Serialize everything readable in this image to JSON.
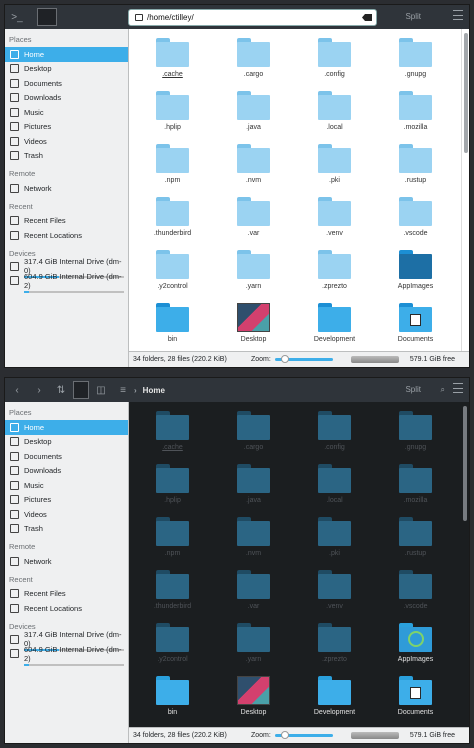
{
  "windows": [
    {
      "path": "/home/ctilley/",
      "split_label": "Split",
      "sidebar": {
        "sections": [
          {
            "title": "Places",
            "items": [
              {
                "label": "Home",
                "icon": "home-icon",
                "selected": true
              },
              {
                "label": "Desktop",
                "icon": "desktop-icon"
              },
              {
                "label": "Documents",
                "icon": "documents-icon"
              },
              {
                "label": "Downloads",
                "icon": "downloads-icon"
              },
              {
                "label": "Music",
                "icon": "music-icon"
              },
              {
                "label": "Pictures",
                "icon": "pictures-icon"
              },
              {
                "label": "Videos",
                "icon": "videos-icon"
              },
              {
                "label": "Trash",
                "icon": "trash-icon"
              }
            ]
          },
          {
            "title": "Remote",
            "items": [
              {
                "label": "Network",
                "icon": "network-icon"
              }
            ]
          },
          {
            "title": "Recent",
            "items": [
              {
                "label": "Recent Files",
                "icon": "recent-files-icon"
              },
              {
                "label": "Recent Locations",
                "icon": "recent-locations-icon"
              }
            ]
          }
        ],
        "devices_title": "Devices",
        "devices": [
          {
            "label": "317.4 GiB Internal Drive (dm-0)",
            "used_fraction": 0.35
          },
          {
            "label": "604.9 GiB Internal Drive (dm-2)",
            "used_fraction": 0.05
          }
        ]
      },
      "files": [
        ".cache",
        ".cargo",
        ".config",
        ".gnupg",
        ".hplip",
        ".java",
        ".local",
        ".mozilla",
        ".npm",
        ".nvm",
        ".pki",
        ".rustup",
        ".thunderbird",
        ".var",
        ".venv",
        ".vscode",
        ".y2control",
        ".yarn",
        ".zprezto",
        "AppImages",
        "bin",
        "Desktop",
        "Development",
        "Documents"
      ],
      "status": {
        "summary": "34 folders, 28 files (220.2 KiB)",
        "zoom_label": "Zoom:",
        "free": "579.1 GiB free"
      }
    },
    {
      "path": "Home",
      "split_label": "Split",
      "sidebar": {
        "sections": [
          {
            "title": "Places",
            "items": [
              {
                "label": "Home",
                "icon": "home-icon",
                "selected": true
              },
              {
                "label": "Desktop",
                "icon": "desktop-icon"
              },
              {
                "label": "Documents",
                "icon": "documents-icon"
              },
              {
                "label": "Downloads",
                "icon": "downloads-icon"
              },
              {
                "label": "Music",
                "icon": "music-icon"
              },
              {
                "label": "Pictures",
                "icon": "pictures-icon"
              },
              {
                "label": "Videos",
                "icon": "videos-icon"
              },
              {
                "label": "Trash",
                "icon": "trash-icon"
              }
            ]
          },
          {
            "title": "Remote",
            "items": [
              {
                "label": "Network",
                "icon": "network-icon"
              }
            ]
          },
          {
            "title": "Recent",
            "items": [
              {
                "label": "Recent Files",
                "icon": "recent-files-icon"
              },
              {
                "label": "Recent Locations",
                "icon": "recent-locations-icon"
              }
            ]
          }
        ],
        "devices_title": "Devices",
        "devices": [
          {
            "label": "317.4 GiB Internal Drive (dm-0)",
            "used_fraction": 0.35
          },
          {
            "label": "604.9 GiB Internal Drive (dm-2)",
            "used_fraction": 0.05
          }
        ]
      },
      "files": [
        ".cache",
        ".cargo",
        ".config",
        ".gnupg",
        ".hplip",
        ".java",
        ".local",
        ".mozilla",
        ".npm",
        ".nvm",
        ".pki",
        ".rustup",
        ".thunderbird",
        ".var",
        ".venv",
        ".vscode",
        ".y2control",
        ".yarn",
        ".zprezto",
        "AppImages",
        "bin",
        "Desktop",
        "Development",
        "Documents"
      ],
      "status": {
        "summary": "34 folders, 28 files (220.2 KiB)",
        "zoom_label": "Zoom:",
        "free": "579.1 GiB free"
      }
    }
  ]
}
